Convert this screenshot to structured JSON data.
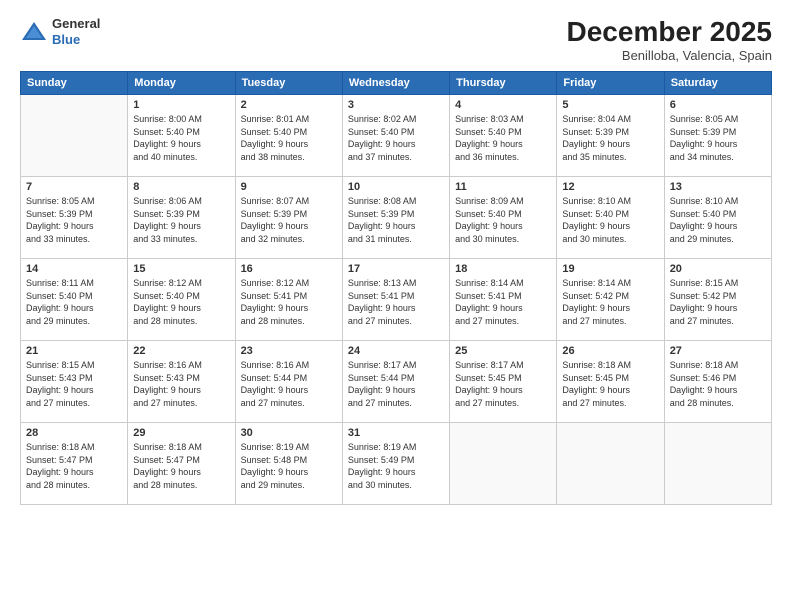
{
  "header": {
    "logo_line1": "General",
    "logo_line2": "Blue",
    "month": "December 2025",
    "location": "Benilloba, Valencia, Spain"
  },
  "weekdays": [
    "Sunday",
    "Monday",
    "Tuesday",
    "Wednesday",
    "Thursday",
    "Friday",
    "Saturday"
  ],
  "weeks": [
    [
      {
        "day": "",
        "info": ""
      },
      {
        "day": "1",
        "info": "Sunrise: 8:00 AM\nSunset: 5:40 PM\nDaylight: 9 hours\nand 40 minutes."
      },
      {
        "day": "2",
        "info": "Sunrise: 8:01 AM\nSunset: 5:40 PM\nDaylight: 9 hours\nand 38 minutes."
      },
      {
        "day": "3",
        "info": "Sunrise: 8:02 AM\nSunset: 5:40 PM\nDaylight: 9 hours\nand 37 minutes."
      },
      {
        "day": "4",
        "info": "Sunrise: 8:03 AM\nSunset: 5:40 PM\nDaylight: 9 hours\nand 36 minutes."
      },
      {
        "day": "5",
        "info": "Sunrise: 8:04 AM\nSunset: 5:39 PM\nDaylight: 9 hours\nand 35 minutes."
      },
      {
        "day": "6",
        "info": "Sunrise: 8:05 AM\nSunset: 5:39 PM\nDaylight: 9 hours\nand 34 minutes."
      }
    ],
    [
      {
        "day": "7",
        "info": "Sunrise: 8:05 AM\nSunset: 5:39 PM\nDaylight: 9 hours\nand 33 minutes."
      },
      {
        "day": "8",
        "info": "Sunrise: 8:06 AM\nSunset: 5:39 PM\nDaylight: 9 hours\nand 33 minutes."
      },
      {
        "day": "9",
        "info": "Sunrise: 8:07 AM\nSunset: 5:39 PM\nDaylight: 9 hours\nand 32 minutes."
      },
      {
        "day": "10",
        "info": "Sunrise: 8:08 AM\nSunset: 5:39 PM\nDaylight: 9 hours\nand 31 minutes."
      },
      {
        "day": "11",
        "info": "Sunrise: 8:09 AM\nSunset: 5:40 PM\nDaylight: 9 hours\nand 30 minutes."
      },
      {
        "day": "12",
        "info": "Sunrise: 8:10 AM\nSunset: 5:40 PM\nDaylight: 9 hours\nand 30 minutes."
      },
      {
        "day": "13",
        "info": "Sunrise: 8:10 AM\nSunset: 5:40 PM\nDaylight: 9 hours\nand 29 minutes."
      }
    ],
    [
      {
        "day": "14",
        "info": "Sunrise: 8:11 AM\nSunset: 5:40 PM\nDaylight: 9 hours\nand 29 minutes."
      },
      {
        "day": "15",
        "info": "Sunrise: 8:12 AM\nSunset: 5:40 PM\nDaylight: 9 hours\nand 28 minutes."
      },
      {
        "day": "16",
        "info": "Sunrise: 8:12 AM\nSunset: 5:41 PM\nDaylight: 9 hours\nand 28 minutes."
      },
      {
        "day": "17",
        "info": "Sunrise: 8:13 AM\nSunset: 5:41 PM\nDaylight: 9 hours\nand 27 minutes."
      },
      {
        "day": "18",
        "info": "Sunrise: 8:14 AM\nSunset: 5:41 PM\nDaylight: 9 hours\nand 27 minutes."
      },
      {
        "day": "19",
        "info": "Sunrise: 8:14 AM\nSunset: 5:42 PM\nDaylight: 9 hours\nand 27 minutes."
      },
      {
        "day": "20",
        "info": "Sunrise: 8:15 AM\nSunset: 5:42 PM\nDaylight: 9 hours\nand 27 minutes."
      }
    ],
    [
      {
        "day": "21",
        "info": "Sunrise: 8:15 AM\nSunset: 5:43 PM\nDaylight: 9 hours\nand 27 minutes."
      },
      {
        "day": "22",
        "info": "Sunrise: 8:16 AM\nSunset: 5:43 PM\nDaylight: 9 hours\nand 27 minutes."
      },
      {
        "day": "23",
        "info": "Sunrise: 8:16 AM\nSunset: 5:44 PM\nDaylight: 9 hours\nand 27 minutes."
      },
      {
        "day": "24",
        "info": "Sunrise: 8:17 AM\nSunset: 5:44 PM\nDaylight: 9 hours\nand 27 minutes."
      },
      {
        "day": "25",
        "info": "Sunrise: 8:17 AM\nSunset: 5:45 PM\nDaylight: 9 hours\nand 27 minutes."
      },
      {
        "day": "26",
        "info": "Sunrise: 8:18 AM\nSunset: 5:45 PM\nDaylight: 9 hours\nand 27 minutes."
      },
      {
        "day": "27",
        "info": "Sunrise: 8:18 AM\nSunset: 5:46 PM\nDaylight: 9 hours\nand 28 minutes."
      }
    ],
    [
      {
        "day": "28",
        "info": "Sunrise: 8:18 AM\nSunset: 5:47 PM\nDaylight: 9 hours\nand 28 minutes."
      },
      {
        "day": "29",
        "info": "Sunrise: 8:18 AM\nSunset: 5:47 PM\nDaylight: 9 hours\nand 28 minutes."
      },
      {
        "day": "30",
        "info": "Sunrise: 8:19 AM\nSunset: 5:48 PM\nDaylight: 9 hours\nand 29 minutes."
      },
      {
        "day": "31",
        "info": "Sunrise: 8:19 AM\nSunset: 5:49 PM\nDaylight: 9 hours\nand 30 minutes."
      },
      {
        "day": "",
        "info": ""
      },
      {
        "day": "",
        "info": ""
      },
      {
        "day": "",
        "info": ""
      }
    ]
  ]
}
